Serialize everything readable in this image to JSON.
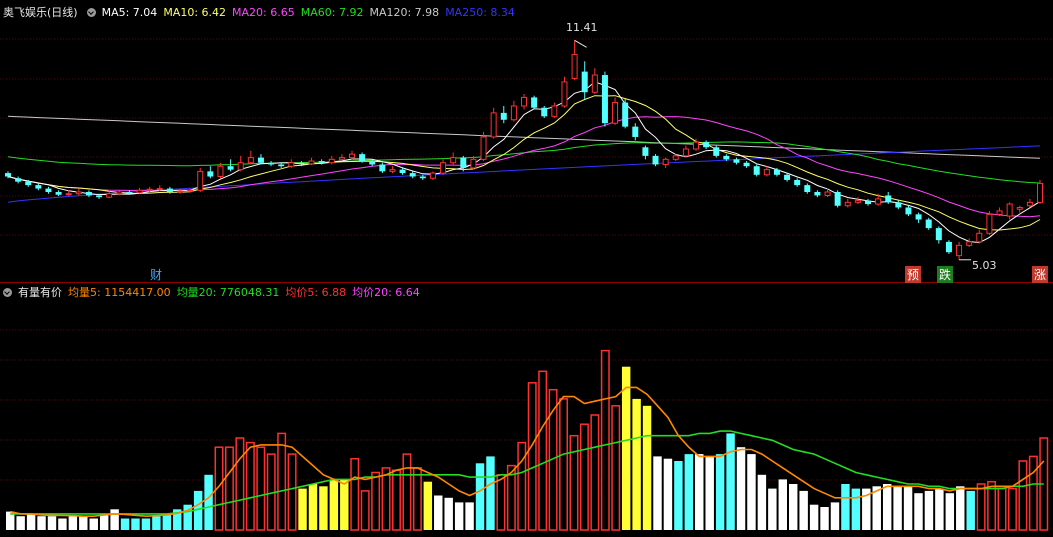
{
  "header": {
    "stock_name": "奥飞娱乐(日线)",
    "ma5": "MA5: 7.04",
    "ma10": "MA10: 6.42",
    "ma20": "MA20: 6.65",
    "ma60": "MA60: 7.92",
    "ma120": "MA120: 7.98",
    "ma250": "MA250: 8.34"
  },
  "volume_header": {
    "indicator_name": "有量有价",
    "vol5": "均量5: 1154417.00",
    "vol20": "均量20: 776048.31",
    "price5": "均价5: 6.88",
    "price20": "均价20: 6.64"
  },
  "markers": {
    "high_label": "11.41",
    "low_label": "5.03",
    "cai": "财",
    "yu": "预",
    "die": "跌",
    "zhang": "涨"
  },
  "colors": {
    "up": "#ff3030",
    "down": "#54ffff",
    "ma5": "#ffffff",
    "ma10": "#ffff66",
    "ma20": "#ff44ff",
    "ma60": "#22dd22",
    "ma120": "#c8c8c8",
    "ma250": "#3333ff",
    "vol5": "#ff8800",
    "vol20": "#22dd22",
    "vol_yellow": "#ffff33",
    "vol_white": "#ffffff"
  },
  "chart_data": [
    {
      "type": "candlestick",
      "title": "奥飞娱乐(日线)",
      "high_marker": 11.41,
      "low_marker": 5.03,
      "ylim": [
        4.5,
        12.0
      ],
      "candles": [
        {
          "o": 7.55,
          "c": 7.45,
          "h": 7.6,
          "l": 7.4
        },
        {
          "o": 7.4,
          "c": 7.3,
          "h": 7.45,
          "l": 7.25
        },
        {
          "o": 7.3,
          "c": 7.2,
          "h": 7.35,
          "l": 7.15
        },
        {
          "o": 7.2,
          "c": 7.1,
          "h": 7.25,
          "l": 7.05
        },
        {
          "o": 7.1,
          "c": 7.0,
          "h": 7.15,
          "l": 6.95
        },
        {
          "o": 7.0,
          "c": 6.92,
          "h": 7.05,
          "l": 6.88
        },
        {
          "o": 6.92,
          "c": 6.95,
          "h": 7.05,
          "l": 6.88
        },
        {
          "o": 6.95,
          "c": 7.0,
          "h": 7.1,
          "l": 6.9
        },
        {
          "o": 7.0,
          "c": 6.9,
          "h": 7.05,
          "l": 6.85
        },
        {
          "o": 6.9,
          "c": 6.85,
          "h": 6.95,
          "l": 6.8
        },
        {
          "o": 6.85,
          "c": 6.95,
          "h": 7.05,
          "l": 6.82
        },
        {
          "o": 6.95,
          "c": 7.0,
          "h": 7.05,
          "l": 6.9
        },
        {
          "o": 7.0,
          "c": 6.98,
          "h": 7.05,
          "l": 6.93
        },
        {
          "o": 6.98,
          "c": 7.05,
          "h": 7.12,
          "l": 6.95
        },
        {
          "o": 7.05,
          "c": 7.08,
          "h": 7.15,
          "l": 7.0
        },
        {
          "o": 7.08,
          "c": 7.1,
          "h": 7.2,
          "l": 7.02
        },
        {
          "o": 7.1,
          "c": 7.0,
          "h": 7.15,
          "l": 6.95
        },
        {
          "o": 7.0,
          "c": 7.03,
          "h": 7.1,
          "l": 6.95
        },
        {
          "o": 7.03,
          "c": 7.05,
          "h": 7.1,
          "l": 6.98
        },
        {
          "o": 7.05,
          "c": 7.6,
          "h": 7.7,
          "l": 7.0
        },
        {
          "o": 7.6,
          "c": 7.45,
          "h": 7.75,
          "l": 7.4
        },
        {
          "o": 7.45,
          "c": 7.75,
          "h": 7.85,
          "l": 7.4
        },
        {
          "o": 7.75,
          "c": 7.65,
          "h": 7.95,
          "l": 7.6
        },
        {
          "o": 7.65,
          "c": 7.85,
          "h": 8.05,
          "l": 7.6
        },
        {
          "o": 7.85,
          "c": 8.0,
          "h": 8.2,
          "l": 7.8
        },
        {
          "o": 8.0,
          "c": 7.85,
          "h": 8.1,
          "l": 7.8
        },
        {
          "o": 7.85,
          "c": 7.8,
          "h": 7.9,
          "l": 7.75
        },
        {
          "o": 7.8,
          "c": 7.75,
          "h": 7.85,
          "l": 7.7
        },
        {
          "o": 7.75,
          "c": 7.85,
          "h": 7.95,
          "l": 7.7
        },
        {
          "o": 7.85,
          "c": 7.82,
          "h": 7.9,
          "l": 7.75
        },
        {
          "o": 7.82,
          "c": 7.9,
          "h": 8.0,
          "l": 7.78
        },
        {
          "o": 7.9,
          "c": 7.85,
          "h": 7.95,
          "l": 7.8
        },
        {
          "o": 7.85,
          "c": 7.95,
          "h": 8.05,
          "l": 7.8
        },
        {
          "o": 7.95,
          "c": 8.0,
          "h": 8.1,
          "l": 7.9
        },
        {
          "o": 8.0,
          "c": 8.1,
          "h": 8.2,
          "l": 7.95
        },
        {
          "o": 8.1,
          "c": 7.9,
          "h": 8.15,
          "l": 7.85
        },
        {
          "o": 7.9,
          "c": 7.8,
          "h": 7.95,
          "l": 7.75
        },
        {
          "o": 7.8,
          "c": 7.6,
          "h": 7.85,
          "l": 7.55
        },
        {
          "o": 7.6,
          "c": 7.65,
          "h": 7.75,
          "l": 7.55
        },
        {
          "o": 7.65,
          "c": 7.55,
          "h": 7.7,
          "l": 7.5
        },
        {
          "o": 7.55,
          "c": 7.45,
          "h": 7.6,
          "l": 7.4
        },
        {
          "o": 7.45,
          "c": 7.4,
          "h": 7.5,
          "l": 7.35
        },
        {
          "o": 7.4,
          "c": 7.55,
          "h": 7.6,
          "l": 7.35
        },
        {
          "o": 7.55,
          "c": 7.85,
          "h": 7.95,
          "l": 7.5
        },
        {
          "o": 7.85,
          "c": 8.0,
          "h": 8.15,
          "l": 7.8
        },
        {
          "o": 8.0,
          "c": 7.7,
          "h": 8.05,
          "l": 7.6
        },
        {
          "o": 7.7,
          "c": 7.95,
          "h": 8.05,
          "l": 7.65
        },
        {
          "o": 7.95,
          "c": 8.6,
          "h": 8.75,
          "l": 7.9
        },
        {
          "o": 8.6,
          "c": 9.3,
          "h": 9.45,
          "l": 8.55
        },
        {
          "o": 9.3,
          "c": 9.1,
          "h": 9.5,
          "l": 9.0
        },
        {
          "o": 9.1,
          "c": 9.5,
          "h": 9.65,
          "l": 9.05
        },
        {
          "o": 9.5,
          "c": 9.75,
          "h": 9.85,
          "l": 9.4
        },
        {
          "o": 9.75,
          "c": 9.45,
          "h": 9.8,
          "l": 9.4
        },
        {
          "o": 9.45,
          "c": 9.2,
          "h": 9.5,
          "l": 9.15
        },
        {
          "o": 9.2,
          "c": 9.5,
          "h": 9.6,
          "l": 9.15
        },
        {
          "o": 9.5,
          "c": 10.2,
          "h": 10.35,
          "l": 9.45
        },
        {
          "o": 10.3,
          "c": 11.0,
          "h": 11.41,
          "l": 10.25
        },
        {
          "o": 10.5,
          "c": 9.9,
          "h": 10.8,
          "l": 9.7
        },
        {
          "o": 9.9,
          "c": 10.4,
          "h": 10.6,
          "l": 9.85
        },
        {
          "o": 10.4,
          "c": 9.0,
          "h": 10.5,
          "l": 8.9
        },
        {
          "o": 9.0,
          "c": 9.6,
          "h": 9.75,
          "l": 8.95
        },
        {
          "o": 9.6,
          "c": 8.9,
          "h": 9.7,
          "l": 8.85
        },
        {
          "o": 8.9,
          "c": 8.6,
          "h": 9.0,
          "l": 8.5
        },
        {
          "o": 8.3,
          "c": 8.05,
          "h": 8.35,
          "l": 7.95
        },
        {
          "o": 8.05,
          "c": 7.8,
          "h": 8.1,
          "l": 7.75
        },
        {
          "o": 7.8,
          "c": 7.95,
          "h": 8.0,
          "l": 7.7
        },
        {
          "o": 7.95,
          "c": 8.05,
          "h": 8.1,
          "l": 7.9
        },
        {
          "o": 8.05,
          "c": 8.25,
          "h": 8.35,
          "l": 8.0
        },
        {
          "o": 8.25,
          "c": 8.45,
          "h": 8.55,
          "l": 8.2
        },
        {
          "o": 8.45,
          "c": 8.3,
          "h": 8.5,
          "l": 8.25
        },
        {
          "o": 8.3,
          "c": 8.05,
          "h": 8.35,
          "l": 8.0
        },
        {
          "o": 8.05,
          "c": 7.95,
          "h": 8.1,
          "l": 7.9
        },
        {
          "o": 7.95,
          "c": 7.85,
          "h": 8.0,
          "l": 7.8
        },
        {
          "o": 7.85,
          "c": 7.75,
          "h": 7.9,
          "l": 7.7
        },
        {
          "o": 7.75,
          "c": 7.5,
          "h": 7.8,
          "l": 7.45
        },
        {
          "o": 7.5,
          "c": 7.65,
          "h": 7.75,
          "l": 7.45
        },
        {
          "o": 7.65,
          "c": 7.5,
          "h": 7.7,
          "l": 7.45
        },
        {
          "o": 7.5,
          "c": 7.35,
          "h": 7.55,
          "l": 7.3
        },
        {
          "o": 7.35,
          "c": 7.2,
          "h": 7.4,
          "l": 7.15
        },
        {
          "o": 7.2,
          "c": 7.0,
          "h": 7.25,
          "l": 6.95
        },
        {
          "o": 7.0,
          "c": 6.9,
          "h": 7.05,
          "l": 6.85
        },
        {
          "o": 6.9,
          "c": 7.0,
          "h": 7.1,
          "l": 6.85
        },
        {
          "o": 7.0,
          "c": 6.6,
          "h": 7.05,
          "l": 6.55
        },
        {
          "o": 6.6,
          "c": 6.7,
          "h": 6.8,
          "l": 6.55
        },
        {
          "o": 6.7,
          "c": 6.75,
          "h": 6.85,
          "l": 6.65
        },
        {
          "o": 6.75,
          "c": 6.65,
          "h": 6.8,
          "l": 6.6
        },
        {
          "o": 6.65,
          "c": 6.8,
          "h": 6.95,
          "l": 6.6
        },
        {
          "o": 6.9,
          "c": 6.7,
          "h": 7.0,
          "l": 6.65
        },
        {
          "o": 6.7,
          "c": 6.55,
          "h": 6.75,
          "l": 6.5
        },
        {
          "o": 6.55,
          "c": 6.35,
          "h": 6.6,
          "l": 6.3
        },
        {
          "o": 6.35,
          "c": 6.2,
          "h": 6.4,
          "l": 6.1
        },
        {
          "o": 6.2,
          "c": 5.95,
          "h": 6.25,
          "l": 5.9
        },
        {
          "o": 5.95,
          "c": 5.6,
          "h": 6.0,
          "l": 5.5
        },
        {
          "o": 5.55,
          "c": 5.25,
          "h": 5.6,
          "l": 5.2
        },
        {
          "o": 5.15,
          "c": 5.45,
          "h": 5.55,
          "l": 5.03
        },
        {
          "o": 5.45,
          "c": 5.55,
          "h": 5.65,
          "l": 5.4
        },
        {
          "o": 5.55,
          "c": 5.8,
          "h": 5.9,
          "l": 5.5
        },
        {
          "o": 5.8,
          "c": 6.35,
          "h": 6.45,
          "l": 5.75
        },
        {
          "o": 6.35,
          "c": 6.45,
          "h": 6.55,
          "l": 6.3
        },
        {
          "o": 6.3,
          "c": 6.65,
          "h": 6.7,
          "l": 6.2
        },
        {
          "o": 6.5,
          "c": 6.55,
          "h": 6.6,
          "l": 6.4
        },
        {
          "o": 6.6,
          "c": 6.7,
          "h": 6.8,
          "l": 6.55
        },
        {
          "o": 6.7,
          "c": 7.25,
          "h": 7.35,
          "l": 6.65
        }
      ],
      "ma_series": [
        {
          "name": "MA5",
          "values_start": 7.4,
          "values_end": 7.04
        },
        {
          "name": "MA10",
          "values_start": 7.3,
          "values_end": 6.42
        },
        {
          "name": "MA20",
          "values_start": 7.35,
          "values_end": 6.65
        },
        {
          "name": "MA60",
          "values_start": 8.6,
          "values_end": 7.92
        },
        {
          "name": "MA120",
          "values_start": 9.2,
          "values_end": 7.98
        },
        {
          "name": "MA250",
          "values_start": 6.7,
          "values_end": 8.34
        }
      ]
    },
    {
      "type": "bar",
      "title": "有量有价",
      "ylim": [
        0,
        1
      ],
      "values": [
        0.08,
        0.06,
        0.07,
        0.06,
        0.06,
        0.05,
        0.06,
        0.06,
        0.05,
        0.07,
        0.09,
        0.05,
        0.05,
        0.05,
        0.06,
        0.07,
        0.09,
        0.11,
        0.17,
        0.24,
        0.36,
        0.36,
        0.4,
        0.38,
        0.36,
        0.33,
        0.42,
        0.33,
        0.18,
        0.2,
        0.19,
        0.22,
        0.22,
        0.31,
        0.17,
        0.25,
        0.27,
        0.26,
        0.33,
        0.27,
        0.21,
        0.15,
        0.14,
        0.12,
        0.12,
        0.29,
        0.32,
        0.24,
        0.28,
        0.38,
        0.64,
        0.69,
        0.61,
        0.57,
        0.41,
        0.46,
        0.5,
        0.78,
        0.54,
        0.71,
        0.57,
        0.54,
        0.32,
        0.31,
        0.3,
        0.33,
        0.33,
        0.32,
        0.33,
        0.42,
        0.36,
        0.33,
        0.24,
        0.18,
        0.22,
        0.2,
        0.17,
        0.11,
        0.1,
        0.12,
        0.2,
        0.18,
        0.18,
        0.19,
        0.2,
        0.19,
        0.19,
        0.16,
        0.17,
        0.18,
        0.16,
        0.19,
        0.17,
        0.2,
        0.21,
        0.18,
        0.18,
        0.3,
        0.32,
        0.4
      ],
      "colors_key": [
        "w",
        "w",
        "w",
        "w",
        "w",
        "w",
        "w",
        "w",
        "w",
        "w",
        "w",
        "c",
        "c",
        "c",
        "c",
        "c",
        "c",
        "c",
        "c",
        "c",
        "r",
        "r",
        "r",
        "r",
        "r",
        "r",
        "r",
        "r",
        "y",
        "y",
        "y",
        "y",
        "y",
        "r",
        "r",
        "r",
        "r",
        "r",
        "r",
        "r",
        "y",
        "w",
        "w",
        "w",
        "w",
        "c",
        "c",
        "r",
        "r",
        "r",
        "r",
        "r",
        "r",
        "r",
        "r",
        "r",
        "r",
        "r",
        "r",
        "y",
        "y",
        "y",
        "w",
        "w",
        "c",
        "c",
        "w",
        "w",
        "c",
        "c",
        "w",
        "w",
        "w",
        "w",
        "w",
        "w",
        "w",
        "w",
        "w",
        "w",
        "c",
        "c",
        "w",
        "w",
        "w",
        "w",
        "w",
        "w",
        "w",
        "w",
        "w",
        "w",
        "c",
        "r",
        "r",
        "r",
        "r",
        "r",
        "r",
        "r"
      ],
      "avg5_line": [
        0.08,
        0.07,
        0.07,
        0.065,
        0.064,
        0.063,
        0.062,
        0.06,
        0.06,
        0.065,
        0.07,
        0.068,
        0.064,
        0.06,
        0.062,
        0.065,
        0.072,
        0.085,
        0.11,
        0.14,
        0.19,
        0.25,
        0.31,
        0.36,
        0.37,
        0.37,
        0.37,
        0.36,
        0.32,
        0.28,
        0.24,
        0.22,
        0.2,
        0.23,
        0.22,
        0.23,
        0.24,
        0.26,
        0.27,
        0.27,
        0.25,
        0.23,
        0.2,
        0.17,
        0.15,
        0.17,
        0.2,
        0.22,
        0.25,
        0.3,
        0.37,
        0.45,
        0.52,
        0.58,
        0.58,
        0.55,
        0.56,
        0.57,
        0.58,
        0.62,
        0.62,
        0.59,
        0.54,
        0.49,
        0.41,
        0.36,
        0.32,
        0.32,
        0.32,
        0.34,
        0.35,
        0.35,
        0.33,
        0.3,
        0.27,
        0.24,
        0.21,
        0.18,
        0.16,
        0.14,
        0.14,
        0.14,
        0.15,
        0.17,
        0.19,
        0.19,
        0.19,
        0.19,
        0.18,
        0.18,
        0.17,
        0.18,
        0.18,
        0.18,
        0.19,
        0.19,
        0.19,
        0.22,
        0.25,
        0.3
      ],
      "avg20_line": [
        0.07,
        0.07,
        0.07,
        0.07,
        0.07,
        0.07,
        0.07,
        0.07,
        0.07,
        0.07,
        0.07,
        0.07,
        0.07,
        0.07,
        0.07,
        0.07,
        0.075,
        0.08,
        0.09,
        0.1,
        0.11,
        0.12,
        0.13,
        0.14,
        0.15,
        0.16,
        0.17,
        0.18,
        0.19,
        0.2,
        0.21,
        0.22,
        0.22,
        0.22,
        0.23,
        0.23,
        0.24,
        0.24,
        0.24,
        0.24,
        0.24,
        0.24,
        0.24,
        0.24,
        0.23,
        0.23,
        0.23,
        0.24,
        0.24,
        0.25,
        0.27,
        0.29,
        0.31,
        0.33,
        0.34,
        0.35,
        0.36,
        0.37,
        0.38,
        0.39,
        0.4,
        0.41,
        0.41,
        0.41,
        0.41,
        0.41,
        0.42,
        0.42,
        0.43,
        0.43,
        0.42,
        0.41,
        0.4,
        0.39,
        0.37,
        0.35,
        0.34,
        0.33,
        0.31,
        0.29,
        0.27,
        0.25,
        0.24,
        0.23,
        0.22,
        0.21,
        0.2,
        0.2,
        0.19,
        0.19,
        0.18,
        0.18,
        0.18,
        0.18,
        0.18,
        0.18,
        0.19,
        0.19,
        0.2,
        0.2
      ]
    }
  ]
}
